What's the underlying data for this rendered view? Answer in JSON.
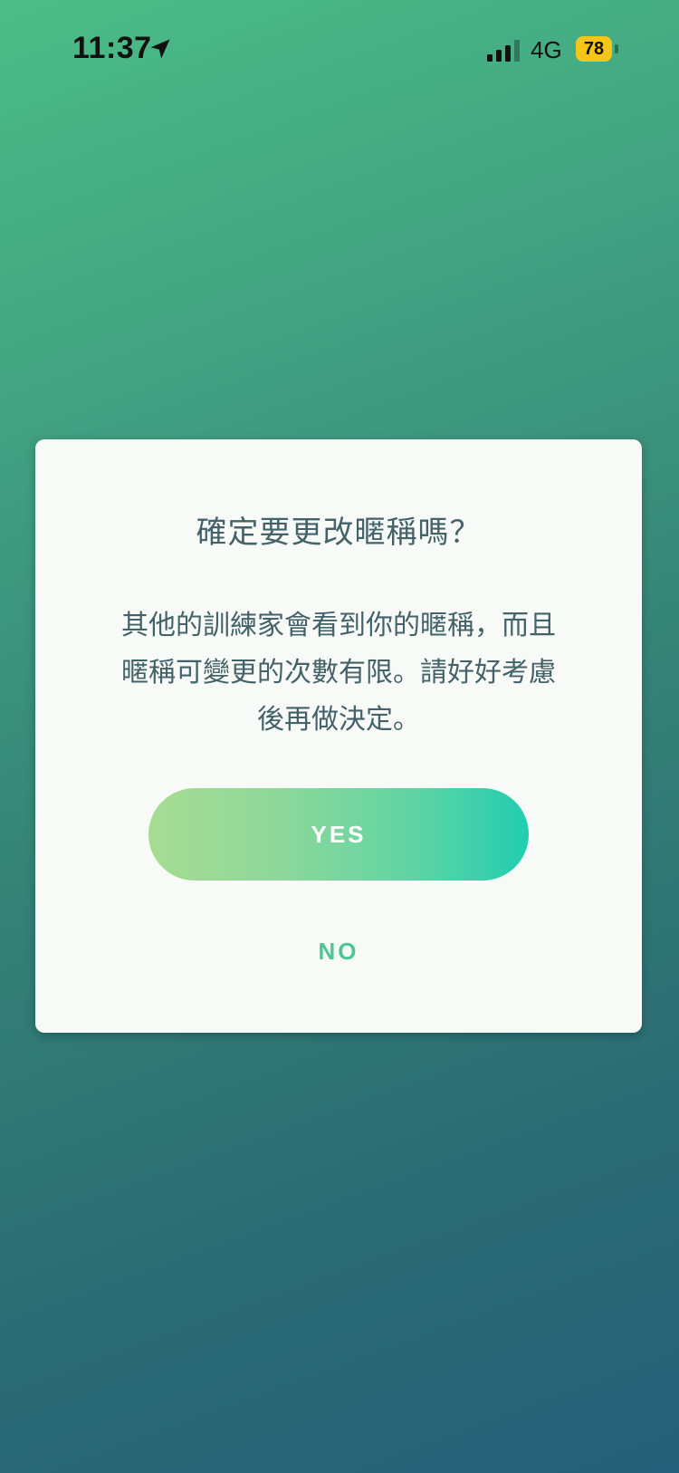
{
  "status_bar": {
    "time": "11:37",
    "network": "4G",
    "battery": "78",
    "icons": {
      "location": "location-arrow-icon",
      "signal": "cellular-signal-icon",
      "battery": "battery-icon"
    },
    "colors": {
      "battery_fill": "#f5c518"
    }
  },
  "dialog": {
    "title": "確定要更改暱稱嗎？",
    "message_lines": [
      "其他的訓練家會看到你的暱稱，而且",
      "暱稱可變更的次數有限。請好好考慮",
      "後再做決定。"
    ],
    "yes_label": "YES",
    "no_label": "NO",
    "colors": {
      "text": "#44626a",
      "yes_gradient_start": "#a6dc92",
      "yes_gradient_end": "#21cdb0",
      "no_text": "#4dc59a",
      "background": "#f7faf6"
    }
  }
}
